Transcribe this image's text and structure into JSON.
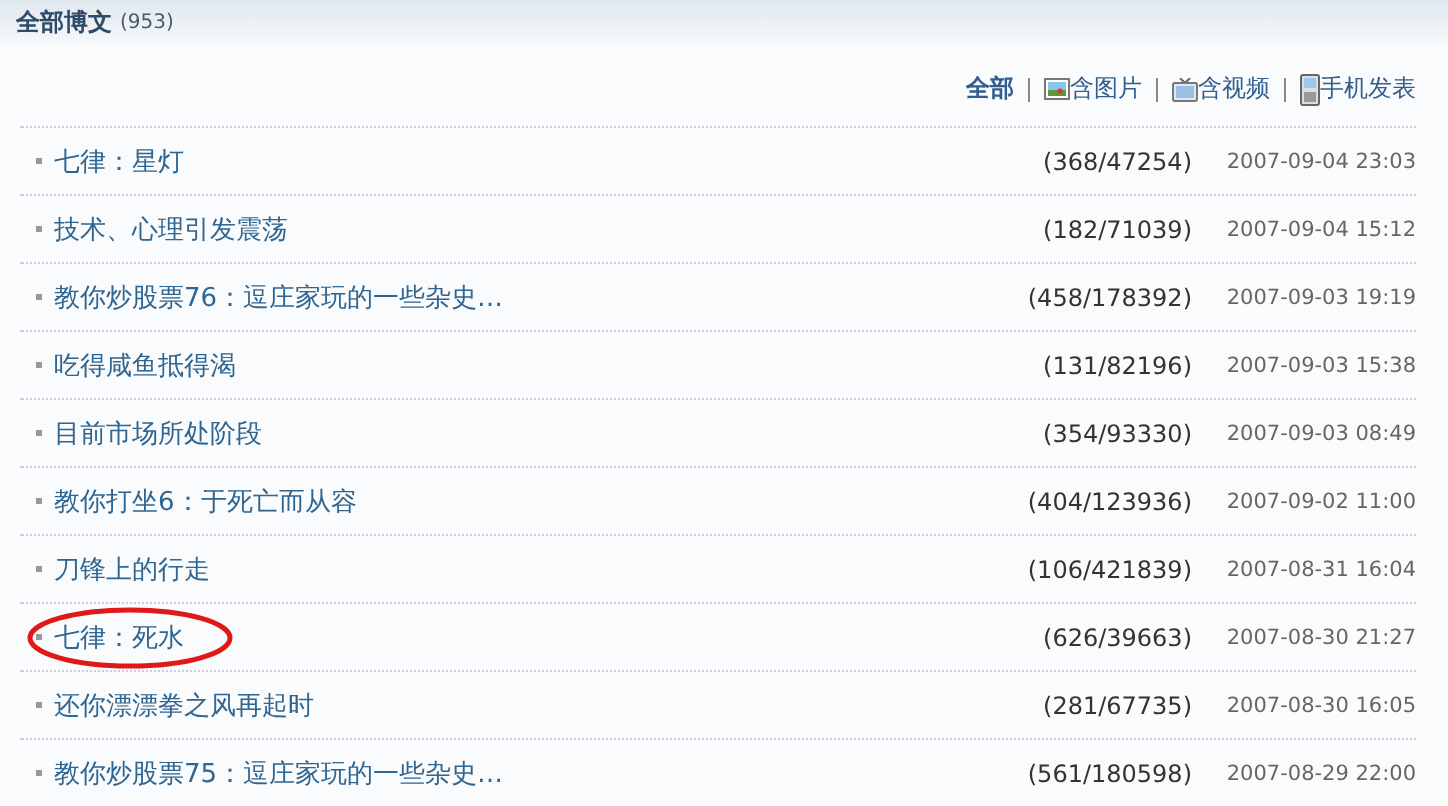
{
  "header": {
    "title": "全部博文",
    "count": "(953)"
  },
  "filters": [
    {
      "label": "全部",
      "kind": "text",
      "selected": true
    },
    {
      "label": "含图片",
      "kind": "picture",
      "selected": false
    },
    {
      "label": "含视频",
      "kind": "video",
      "selected": false
    },
    {
      "label": "手机发表",
      "kind": "phone",
      "selected": false
    }
  ],
  "posts": [
    {
      "title": "七律：星灯",
      "stats": "(368/47254)",
      "date": "2007-09-04 23:03",
      "circled": false
    },
    {
      "title": "技术、心理引发震荡",
      "stats": "(182/71039)",
      "date": "2007-09-04 15:12",
      "circled": false
    },
    {
      "title": "教你炒股票76：逗庄家玩的一些杂史…",
      "stats": "(458/178392)",
      "date": "2007-09-03 19:19",
      "circled": false
    },
    {
      "title": "吃得咸鱼抵得渴",
      "stats": "(131/82196)",
      "date": "2007-09-03 15:38",
      "circled": false
    },
    {
      "title": "目前市场所处阶段",
      "stats": "(354/93330)",
      "date": "2007-09-03 08:49",
      "circled": false
    },
    {
      "title": "教你打坐6：于死亡而从容",
      "stats": "(404/123936)",
      "date": "2007-09-02 11:00",
      "circled": false
    },
    {
      "title": "刀锋上的行走",
      "stats": "(106/421839)",
      "date": "2007-08-31 16:04",
      "circled": false
    },
    {
      "title": "七律：死水",
      "stats": "(626/39663)",
      "date": "2007-08-30 21:27",
      "circled": true
    },
    {
      "title": "还你漂漂拳之风再起时",
      "stats": "(281/67735)",
      "date": "2007-08-30 16:05",
      "circled": false
    },
    {
      "title": "教你炒股票75：逗庄家玩的一些杂史…",
      "stats": "(561/180598)",
      "date": "2007-08-29 22:00",
      "circled": false
    }
  ]
}
